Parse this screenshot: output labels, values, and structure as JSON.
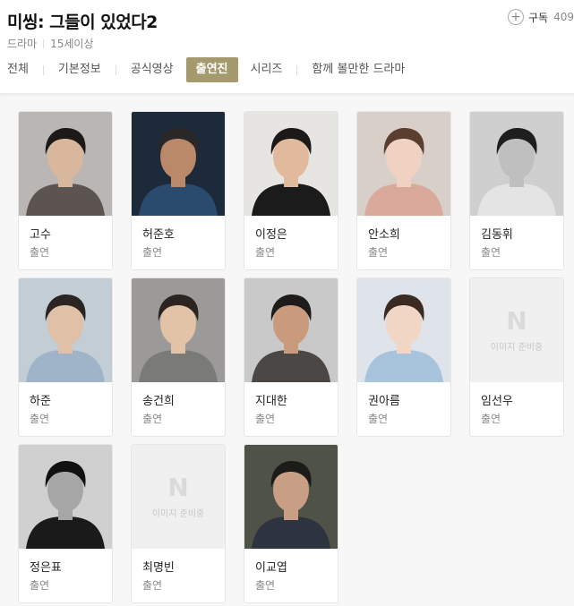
{
  "title": "미씽: 그들이 있었다2",
  "meta": {
    "genre": "드라마",
    "rating": "15세이상"
  },
  "subscribe": {
    "label": "구독",
    "count": "409"
  },
  "tabs": [
    {
      "label": "전체",
      "active": false
    },
    {
      "label": "기본정보",
      "active": false
    },
    {
      "label": "공식영상",
      "active": false
    },
    {
      "label": "출연진",
      "active": true
    },
    {
      "label": "시리즈",
      "active": false
    },
    {
      "label": "함께 볼만한 드라마",
      "active": false
    }
  ],
  "placeholder": {
    "logo": "N",
    "text": "이미지 준비중"
  },
  "cast": [
    {
      "name": "고수",
      "role": "출연",
      "photo": "photo",
      "bg": "#b9b6b3",
      "skin": "#d9b79c",
      "hair": "#1c1917",
      "cloth": "#5b5450"
    },
    {
      "name": "허준호",
      "role": "출연",
      "photo": "photo",
      "bg": "#1d2a3a",
      "skin": "#b9896a",
      "hair": "#2a2826",
      "cloth": "#2a4a6e"
    },
    {
      "name": "이정은",
      "role": "출연",
      "photo": "photo",
      "bg": "#e7e5e2",
      "skin": "#e1b99c",
      "hair": "#1c1a18",
      "cloth": "#1b1b1b"
    },
    {
      "name": "안소희",
      "role": "출연",
      "photo": "photo",
      "bg": "#d8cfc8",
      "skin": "#f0d2c2",
      "hair": "#5a3f30",
      "cloth": "#d9a99c"
    },
    {
      "name": "김동휘",
      "role": "출연",
      "photo": "photo",
      "bg": "#cfcfcf",
      "skin": "#bfbfbf",
      "hair": "#1e1e1e",
      "cloth": "#e4e4e4"
    },
    {
      "name": "하준",
      "role": "출연",
      "photo": "photo",
      "bg": "#c3cdd6",
      "skin": "#e0c0a6",
      "hair": "#2a2522",
      "cloth": "#9fb4c9"
    },
    {
      "name": "송건희",
      "role": "출연",
      "photo": "photo",
      "bg": "#9b9a98",
      "skin": "#e2c3a8",
      "hair": "#2b2420",
      "cloth": "#7a7a78"
    },
    {
      "name": "지대한",
      "role": "출연",
      "photo": "photo",
      "bg": "#c9c9c9",
      "skin": "#c99a7c",
      "hair": "#1e1c1a",
      "cloth": "#4a4744"
    },
    {
      "name": "권아름",
      "role": "출연",
      "photo": "photo",
      "bg": "#dfe3ea",
      "skin": "#f1d6c6",
      "hair": "#3b2a22",
      "cloth": "#a8c4dd"
    },
    {
      "name": "임선우",
      "role": "출연",
      "photo": "placeholder"
    },
    {
      "name": "정은표",
      "role": "출연",
      "photo": "photo",
      "bg": "#d0d0d0",
      "skin": "#a6a6a6",
      "hair": "#111111",
      "cloth": "#1a1a1a"
    },
    {
      "name": "최명빈",
      "role": "출연",
      "photo": "placeholder"
    },
    {
      "name": "이교엽",
      "role": "출연",
      "photo": "photo",
      "bg": "#4f5247",
      "skin": "#c89f84",
      "hair": "#1b1b1a",
      "cloth": "#2e3340"
    }
  ]
}
